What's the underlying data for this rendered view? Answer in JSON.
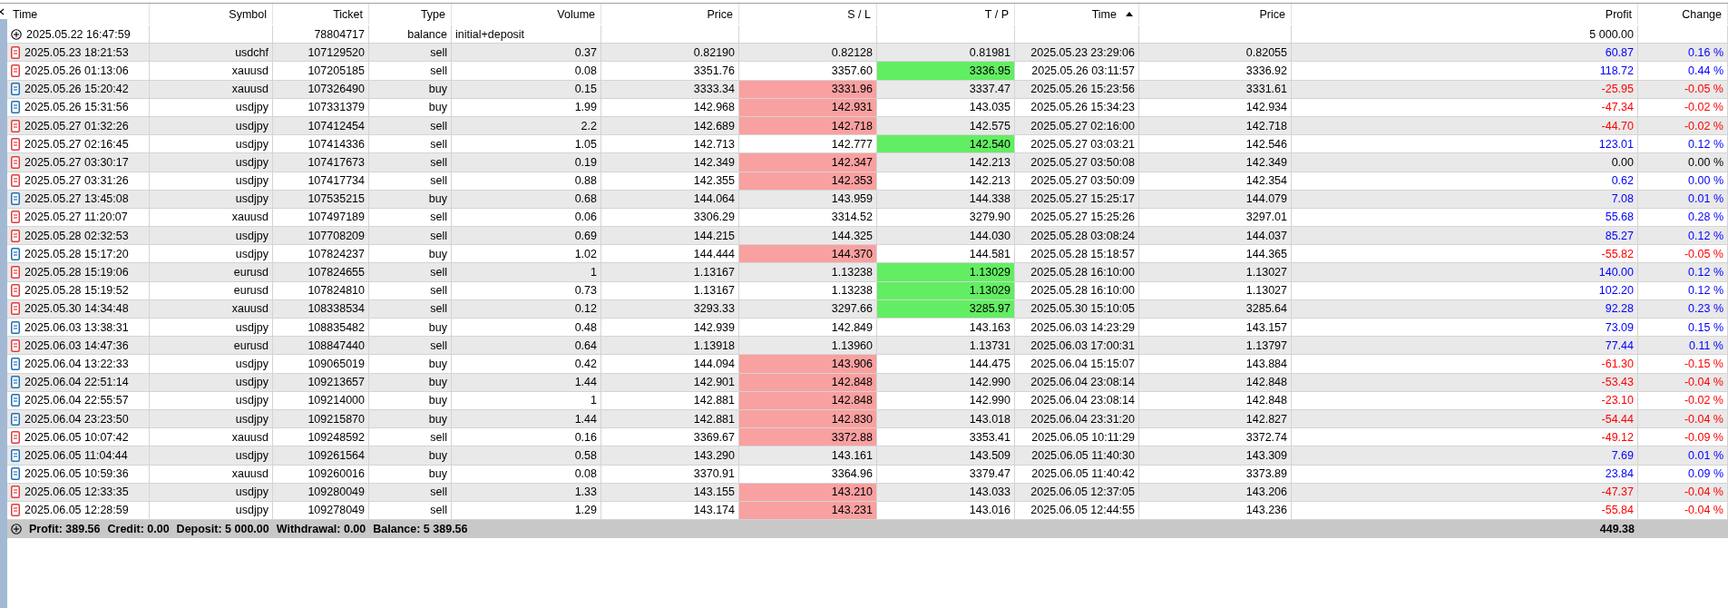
{
  "table": {
    "columns": [
      {
        "label": "Time",
        "sorted": false
      },
      {
        "label": "Symbol",
        "sorted": false
      },
      {
        "label": "Ticket",
        "sorted": false
      },
      {
        "label": "Type",
        "sorted": false
      },
      {
        "label": "Volume",
        "sorted": false
      },
      {
        "label": "Price",
        "sorted": false
      },
      {
        "label": "S / L",
        "sorted": false
      },
      {
        "label": "T / P",
        "sorted": false
      },
      {
        "label": "Time",
        "sorted": true
      },
      {
        "label": "Price",
        "sorted": false
      },
      {
        "label": "Profit",
        "sorted": false
      },
      {
        "label": "Change",
        "sorted": false
      }
    ],
    "balance_row": {
      "time": "2025.05.22 16:47:59",
      "ticket": "78804717",
      "type": "balance",
      "comment": "initial+deposit",
      "profit": "5 000.00"
    },
    "rows": [
      {
        "kind": "sell",
        "time": "2025.05.23 18:21:53",
        "symbol": "usdchf",
        "ticket": "107129520",
        "type": "sell",
        "volume": "0.37",
        "price": "0.82190",
        "sl": "0.82128",
        "sl_hit": false,
        "tp": "0.81981",
        "tp_hit": false,
        "close_time": "2025.05.23 23:29:06",
        "close_price": "0.82055",
        "profit": "60.87",
        "change": "0.16 %",
        "color": "#0000ff"
      },
      {
        "kind": "sell",
        "time": "2025.05.26 01:13:06",
        "symbol": "xauusd",
        "ticket": "107205185",
        "type": "sell",
        "volume": "0.08",
        "price": "3351.76",
        "sl": "3357.60",
        "sl_hit": false,
        "tp": "3336.95",
        "tp_hit": true,
        "close_time": "2025.05.26 03:11:57",
        "close_price": "3336.92",
        "profit": "118.72",
        "change": "0.44 %",
        "color": "#0000ff"
      },
      {
        "kind": "buy",
        "time": "2025.05.26 15:20:42",
        "symbol": "xauusd",
        "ticket": "107326490",
        "type": "buy",
        "volume": "0.15",
        "price": "3333.34",
        "sl": "3331.96",
        "sl_hit": true,
        "tp": "3337.47",
        "tp_hit": false,
        "close_time": "2025.05.26 15:23:56",
        "close_price": "3331.61",
        "profit": "-25.95",
        "change": "-0.05 %",
        "color": "#ff0000"
      },
      {
        "kind": "buy",
        "time": "2025.05.26 15:31:56",
        "symbol": "usdjpy",
        "ticket": "107331379",
        "type": "buy",
        "volume": "1.99",
        "price": "142.968",
        "sl": "142.931",
        "sl_hit": true,
        "tp": "143.035",
        "tp_hit": false,
        "close_time": "2025.05.26 15:34:23",
        "close_price": "142.934",
        "profit": "-47.34",
        "change": "-0.02 %",
        "color": "#ff0000"
      },
      {
        "kind": "sell",
        "time": "2025.05.27 01:32:26",
        "symbol": "usdjpy",
        "ticket": "107412454",
        "type": "sell",
        "volume": "2.2",
        "price": "142.689",
        "sl": "142.718",
        "sl_hit": true,
        "tp": "142.575",
        "tp_hit": false,
        "close_time": "2025.05.27 02:16:00",
        "close_price": "142.718",
        "profit": "-44.70",
        "change": "-0.02 %",
        "color": "#ff0000"
      },
      {
        "kind": "sell",
        "time": "2025.05.27 02:16:45",
        "symbol": "usdjpy",
        "ticket": "107414336",
        "type": "sell",
        "volume": "1.05",
        "price": "142.713",
        "sl": "142.777",
        "sl_hit": false,
        "tp": "142.540",
        "tp_hit": true,
        "close_time": "2025.05.27 03:03:21",
        "close_price": "142.546",
        "profit": "123.01",
        "change": "0.12 %",
        "color": "#0000ff"
      },
      {
        "kind": "sell",
        "time": "2025.05.27 03:30:17",
        "symbol": "usdjpy",
        "ticket": "107417673",
        "type": "sell",
        "volume": "0.19",
        "price": "142.349",
        "sl": "142.347",
        "sl_hit": true,
        "tp": "142.213",
        "tp_hit": false,
        "close_time": "2025.05.27 03:50:08",
        "close_price": "142.349",
        "profit": "0.00",
        "change": "0.00 %",
        "color": "#000000"
      },
      {
        "kind": "sell",
        "time": "2025.05.27 03:31:26",
        "symbol": "usdjpy",
        "ticket": "107417734",
        "type": "sell",
        "volume": "0.88",
        "price": "142.355",
        "sl": "142.353",
        "sl_hit": true,
        "tp": "142.213",
        "tp_hit": false,
        "close_time": "2025.05.27 03:50:09",
        "close_price": "142.354",
        "profit": "0.62",
        "change": "0.00 %",
        "color": "#0000ff"
      },
      {
        "kind": "buy",
        "time": "2025.05.27 13:45:08",
        "symbol": "usdjpy",
        "ticket": "107535215",
        "type": "buy",
        "volume": "0.68",
        "price": "144.064",
        "sl": "143.959",
        "sl_hit": false,
        "tp": "144.338",
        "tp_hit": false,
        "close_time": "2025.05.27 15:25:17",
        "close_price": "144.079",
        "profit": "7.08",
        "change": "0.01 %",
        "color": "#0000ff"
      },
      {
        "kind": "sell",
        "time": "2025.05.27 11:20:07",
        "symbol": "xauusd",
        "ticket": "107497189",
        "type": "sell",
        "volume": "0.06",
        "price": "3306.29",
        "sl": "3314.52",
        "sl_hit": false,
        "tp": "3279.90",
        "tp_hit": false,
        "close_time": "2025.05.27 15:25:26",
        "close_price": "3297.01",
        "profit": "55.68",
        "change": "0.28 %",
        "color": "#0000ff"
      },
      {
        "kind": "sell",
        "time": "2025.05.28 02:32:53",
        "symbol": "usdjpy",
        "ticket": "107708209",
        "type": "sell",
        "volume": "0.69",
        "price": "144.215",
        "sl": "144.325",
        "sl_hit": false,
        "tp": "144.030",
        "tp_hit": false,
        "close_time": "2025.05.28 03:08:24",
        "close_price": "144.037",
        "profit": "85.27",
        "change": "0.12 %",
        "color": "#0000ff"
      },
      {
        "kind": "buy",
        "time": "2025.05.28 15:17:20",
        "symbol": "usdjpy",
        "ticket": "107824237",
        "type": "buy",
        "volume": "1.02",
        "price": "144.444",
        "sl": "144.370",
        "sl_hit": true,
        "tp": "144.581",
        "tp_hit": false,
        "close_time": "2025.05.28 15:18:57",
        "close_price": "144.365",
        "profit": "-55.82",
        "change": "-0.05 %",
        "color": "#ff0000"
      },
      {
        "kind": "sell",
        "time": "2025.05.28 15:19:06",
        "symbol": "eurusd",
        "ticket": "107824655",
        "type": "sell",
        "volume": "1",
        "price": "1.13167",
        "sl": "1.13238",
        "sl_hit": false,
        "tp": "1.13029",
        "tp_hit": true,
        "close_time": "2025.05.28 16:10:00",
        "close_price": "1.13027",
        "profit": "140.00",
        "change": "0.12 %",
        "color": "#0000ff"
      },
      {
        "kind": "sell",
        "time": "2025.05.28 15:19:52",
        "symbol": "eurusd",
        "ticket": "107824810",
        "type": "sell",
        "volume": "0.73",
        "price": "1.13167",
        "sl": "1.13238",
        "sl_hit": false,
        "tp": "1.13029",
        "tp_hit": true,
        "close_time": "2025.05.28 16:10:00",
        "close_price": "1.13027",
        "profit": "102.20",
        "change": "0.12 %",
        "color": "#0000ff"
      },
      {
        "kind": "sell",
        "time": "2025.05.30 14:34:48",
        "symbol": "xauusd",
        "ticket": "108338534",
        "type": "sell",
        "volume": "0.12",
        "price": "3293.33",
        "sl": "3297.66",
        "sl_hit": false,
        "tp": "3285.97",
        "tp_hit": true,
        "close_time": "2025.05.30 15:10:05",
        "close_price": "3285.64",
        "profit": "92.28",
        "change": "0.23 %",
        "color": "#0000ff"
      },
      {
        "kind": "buy",
        "time": "2025.06.03 13:38:31",
        "symbol": "usdjpy",
        "ticket": "108835482",
        "type": "buy",
        "volume": "0.48",
        "price": "142.939",
        "sl": "142.849",
        "sl_hit": false,
        "tp": "143.163",
        "tp_hit": false,
        "close_time": "2025.06.03 14:23:29",
        "close_price": "143.157",
        "profit": "73.09",
        "change": "0.15 %",
        "color": "#0000ff"
      },
      {
        "kind": "sell",
        "time": "2025.06.03 14:47:36",
        "symbol": "eurusd",
        "ticket": "108847440",
        "type": "sell",
        "volume": "0.64",
        "price": "1.13918",
        "sl": "1.13960",
        "sl_hit": false,
        "tp": "1.13731",
        "tp_hit": false,
        "close_time": "2025.06.03 17:00:31",
        "close_price": "1.13797",
        "profit": "77.44",
        "change": "0.11 %",
        "color": "#0000ff"
      },
      {
        "kind": "buy",
        "time": "2025.06.04 13:22:33",
        "symbol": "usdjpy",
        "ticket": "109065019",
        "type": "buy",
        "volume": "0.42",
        "price": "144.094",
        "sl": "143.906",
        "sl_hit": true,
        "tp": "144.475",
        "tp_hit": false,
        "close_time": "2025.06.04 15:15:07",
        "close_price": "143.884",
        "profit": "-61.30",
        "change": "-0.15 %",
        "color": "#ff0000"
      },
      {
        "kind": "buy",
        "time": "2025.06.04 22:51:14",
        "symbol": "usdjpy",
        "ticket": "109213657",
        "type": "buy",
        "volume": "1.44",
        "price": "142.901",
        "sl": "142.848",
        "sl_hit": true,
        "tp": "142.990",
        "tp_hit": false,
        "close_time": "2025.06.04 23:08:14",
        "close_price": "142.848",
        "profit": "-53.43",
        "change": "-0.04 %",
        "color": "#ff0000"
      },
      {
        "kind": "buy",
        "time": "2025.06.04 22:55:57",
        "symbol": "usdjpy",
        "ticket": "109214000",
        "type": "buy",
        "volume": "1",
        "price": "142.881",
        "sl": "142.848",
        "sl_hit": true,
        "tp": "142.990",
        "tp_hit": false,
        "close_time": "2025.06.04 23:08:14",
        "close_price": "142.848",
        "profit": "-23.10",
        "change": "-0.02 %",
        "color": "#ff0000"
      },
      {
        "kind": "buy",
        "time": "2025.06.04 23:23:50",
        "symbol": "usdjpy",
        "ticket": "109215870",
        "type": "buy",
        "volume": "1.44",
        "price": "142.881",
        "sl": "142.830",
        "sl_hit": true,
        "tp": "143.018",
        "tp_hit": false,
        "close_time": "2025.06.04 23:31:20",
        "close_price": "142.827",
        "profit": "-54.44",
        "change": "-0.04 %",
        "color": "#ff0000"
      },
      {
        "kind": "sell",
        "time": "2025.06.05 10:07:42",
        "symbol": "xauusd",
        "ticket": "109248592",
        "type": "sell",
        "volume": "0.16",
        "price": "3369.67",
        "sl": "3372.88",
        "sl_hit": true,
        "tp": "3353.41",
        "tp_hit": false,
        "close_time": "2025.06.05 10:11:29",
        "close_price": "3372.74",
        "profit": "-49.12",
        "change": "-0.09 %",
        "color": "#ff0000"
      },
      {
        "kind": "buy",
        "time": "2025.06.05 11:04:44",
        "symbol": "usdjpy",
        "ticket": "109261564",
        "type": "buy",
        "volume": "0.58",
        "price": "143.290",
        "sl": "143.161",
        "sl_hit": false,
        "tp": "143.509",
        "tp_hit": false,
        "close_time": "2025.06.05 11:40:30",
        "close_price": "143.309",
        "profit": "7.69",
        "change": "0.01 %",
        "color": "#0000ff"
      },
      {
        "kind": "buy",
        "time": "2025.06.05 10:59:36",
        "symbol": "xauusd",
        "ticket": "109260016",
        "type": "buy",
        "volume": "0.08",
        "price": "3370.91",
        "sl": "3364.96",
        "sl_hit": false,
        "tp": "3379.47",
        "tp_hit": false,
        "close_time": "2025.06.05 11:40:42",
        "close_price": "3373.89",
        "profit": "23.84",
        "change": "0.09 %",
        "color": "#0000ff"
      },
      {
        "kind": "sell",
        "time": "2025.06.05 12:33:35",
        "symbol": "usdjpy",
        "ticket": "109280049",
        "type": "sell",
        "volume": "1.33",
        "price": "143.155",
        "sl": "143.210",
        "sl_hit": true,
        "tp": "143.033",
        "tp_hit": false,
        "close_time": "2025.06.05 12:37:05",
        "close_price": "143.206",
        "profit": "-47.37",
        "change": "-0.04 %",
        "color": "#ff0000"
      },
      {
        "kind": "sell",
        "time": "2025.06.05 12:28:59",
        "symbol": "usdjpy",
        "ticket": "109278049",
        "type": "sell",
        "volume": "1.29",
        "price": "143.174",
        "sl": "143.231",
        "sl_hit": true,
        "tp": "143.016",
        "tp_hit": false,
        "close_time": "2025.06.05 12:44:55",
        "close_price": "143.236",
        "profit": "-55.84",
        "change": "-0.04 %",
        "color": "#ff0000"
      }
    ],
    "summary": {
      "items": [
        "Profit: 389.56",
        "Credit: 0.00",
        "Deposit: 5 000.00",
        "Withdrawal: 0.00",
        "Balance: 5 389.56"
      ],
      "total": "449.38"
    }
  }
}
